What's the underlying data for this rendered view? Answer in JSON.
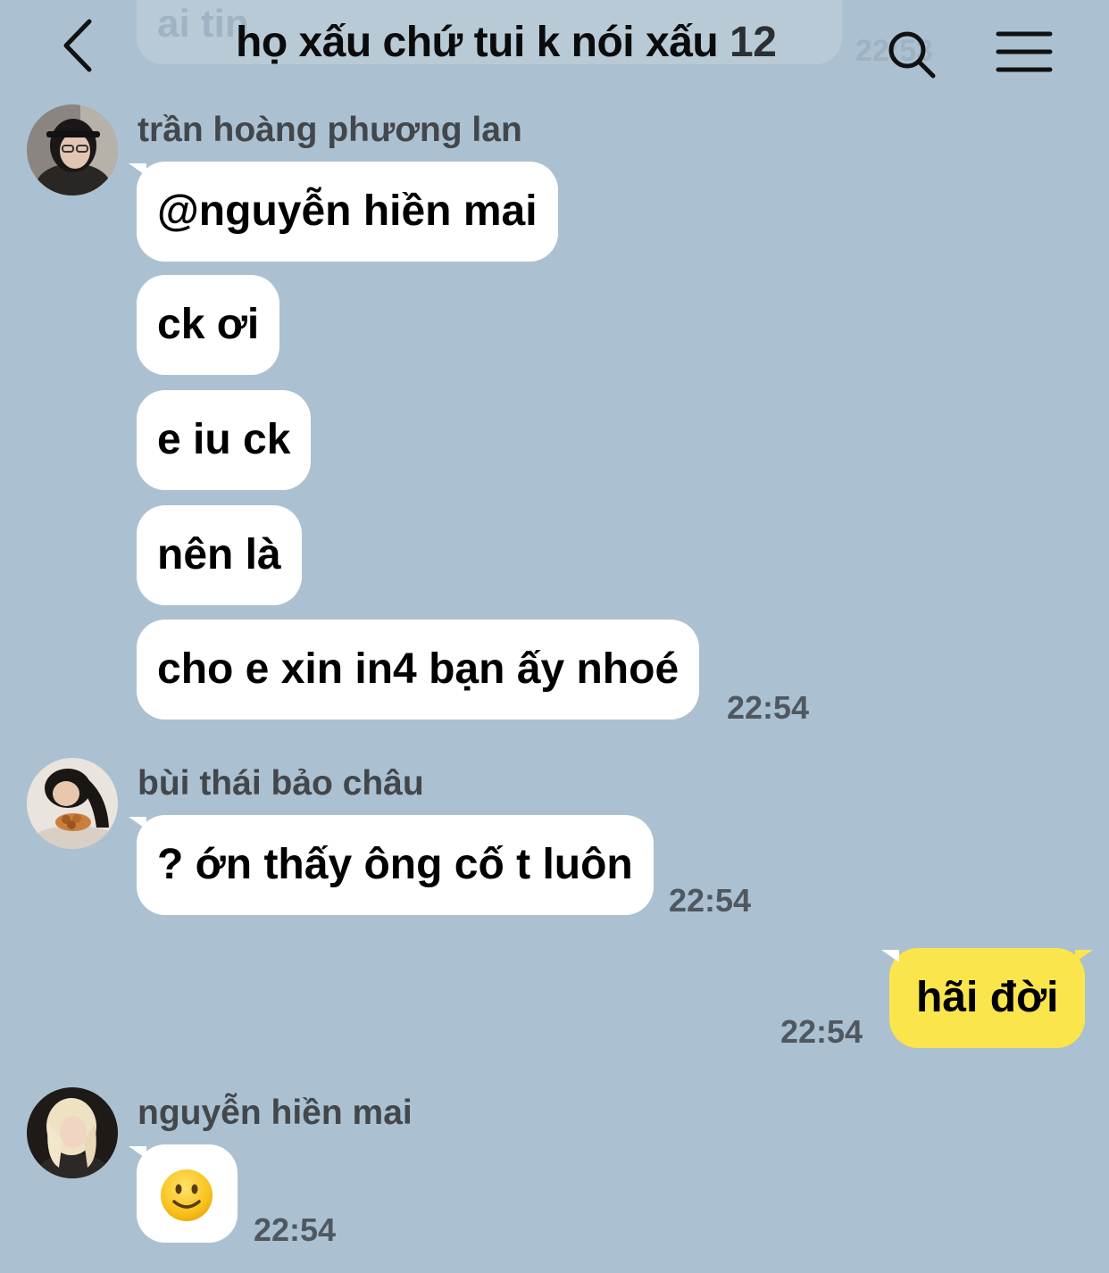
{
  "header": {
    "title": "họ xấu chứ tui k nói xấu",
    "member_count": "12",
    "back_icon": "chevron-left-icon",
    "search_icon": "search-icon",
    "menu_icon": "hamburger-menu-icon"
  },
  "previous": {
    "text": "ai tin",
    "time": "22:53"
  },
  "messages": [
    {
      "sender": "trần hoàng phương lan",
      "bubbles": [
        "@nguyễn hiền mai",
        "ck ơi",
        "e iu ck",
        "nên là",
        "cho e xin in4 bạn ấy nhoé"
      ],
      "time": "22:54"
    },
    {
      "sender": "bùi thái bảo châu",
      "bubbles": [
        "? ớn thấy ông cố t luôn"
      ],
      "time": "22:54"
    },
    {
      "sender": "me",
      "bubbles": [
        "hãi đời"
      ],
      "time": "22:54"
    },
    {
      "sender": "nguyễn hiền mai",
      "bubbles": [
        "🙂"
      ],
      "time": "22:54"
    }
  ],
  "colors": {
    "background": "#abc1d1",
    "incoming_bubble": "#ffffff",
    "outgoing_bubble": "#fae54d"
  }
}
